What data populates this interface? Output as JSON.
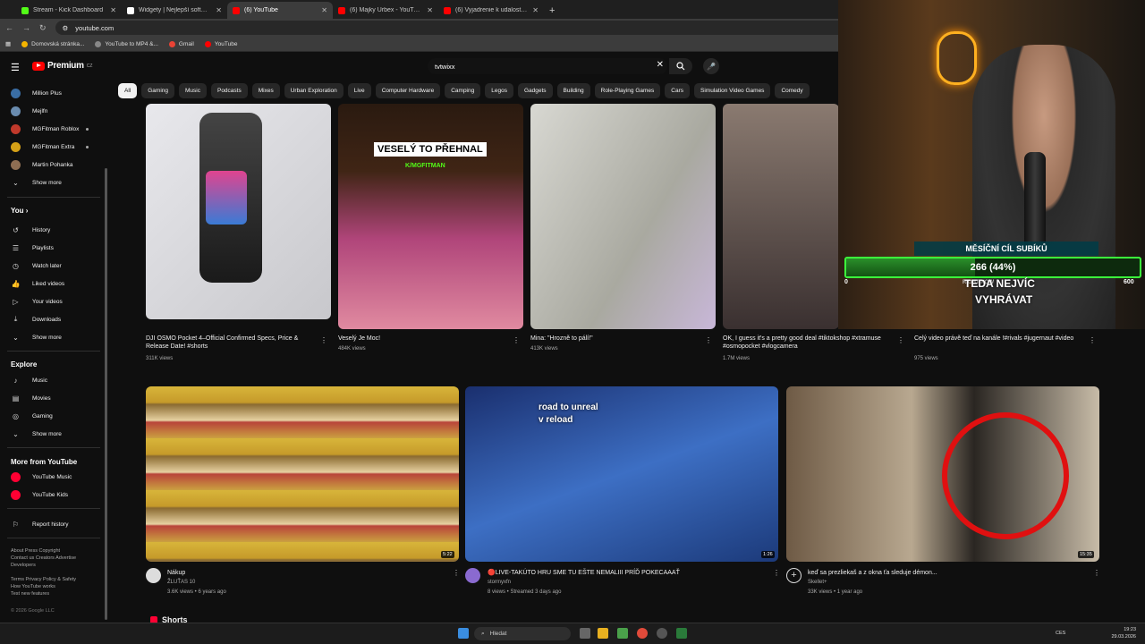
{
  "browser": {
    "tabs": [
      {
        "label": "Stream - Kick Dashboard",
        "favicon_color": "#53fc18"
      },
      {
        "label": "Widgety | Nejlepší software pro...",
        "favicon_color": "#ffffff"
      },
      {
        "label": "(6) YouTube",
        "favicon_color": "#ff0000",
        "active": true
      },
      {
        "label": "(6) Majky Urbex - YouTube",
        "favicon_color": "#ff0000"
      },
      {
        "label": "(6) Vyjadrenie k udalostiam v D...",
        "favicon_color": "#ff0000"
      }
    ],
    "url": "youtube.com",
    "bookmarks": [
      "Domovská stránka...",
      "YouTube to MP4 &...",
      "Gmail",
      "YouTube"
    ]
  },
  "youtube": {
    "brand": "Premium",
    "brand_sup": "CZ",
    "search_value": "tvtwixx",
    "chips": [
      "All",
      "Gaming",
      "Music",
      "Podcasts",
      "Mixes",
      "Urban Exploration",
      "Live",
      "Computer Hardware",
      "Camping",
      "Legos",
      "Gadgets",
      "Building",
      "Role-Playing Games",
      "Cars",
      "Simulation Video Games",
      "Comedy"
    ]
  },
  "sidebar": {
    "subscriptions": [
      {
        "label": "Million Plus",
        "color": "#3a6ea5"
      },
      {
        "label": "Mejlfn",
        "color": "#6a8caf"
      },
      {
        "label": "MGFitman Roblox",
        "color": "#c0392b"
      },
      {
        "label": "MGFitman Extra",
        "color": "#d4a017"
      },
      {
        "label": "Martin Pohanka",
        "color": "#8e6e53"
      }
    ],
    "show_more": "Show more",
    "you_heading": "You",
    "you_items": [
      "History",
      "Playlists",
      "Watch later",
      "Liked videos",
      "Your videos",
      "Downloads"
    ],
    "explore_heading": "Explore",
    "explore_items": [
      "Music",
      "Movies",
      "Gaming"
    ],
    "more_heading": "More from YouTube",
    "more_items": [
      "YouTube Music",
      "YouTube Kids"
    ],
    "report": "Report history",
    "footer1": "About  Press  Copyright",
    "footer2": "Contact us  Creators  Advertise",
    "footer3": "Developers",
    "footer4": "Terms  Privacy  Policy & Safety",
    "footer5": "How YouTube works",
    "footer6": "Test new features",
    "copyright": "© 2026 Google LLC"
  },
  "videos_row1": [
    {
      "title": "DJI OSMO Pocket 4–Official Confirmed Specs, Price & Release Date! #shorts",
      "meta": "311K views"
    },
    {
      "title": "Veselý Je Moc!",
      "meta": "484K views",
      "overlay": "VESELÝ TO PŘEHNAL",
      "overlay2": "K/MGFITMAN"
    },
    {
      "title": "Mina: \"Hrozně to pálí!\"",
      "meta": "413K views"
    },
    {
      "title": "OK, I guess it's a pretty good deal #tiktokshop #xtramuse #osmopocket #vlogcamera",
      "meta": "1.7M views"
    },
    {
      "title": "Celý video právě teď na kanále !#rivals #jugernaut #video",
      "meta": "975 views",
      "overlay": "TEDA NEJVÍC",
      "overlay2": "VYHRÁVAT"
    }
  ],
  "videos_row2": [
    {
      "title": "Nákup",
      "channel": "ŽLUŤAS 10",
      "meta": "3.6K views • 6 years ago",
      "duration": "5:22"
    },
    {
      "title": "🔴LIVE-TAKÚTO HRU SME TU EŠTE NEMALIII PRÍĎ POKECAAAŤ",
      "channel": "stormyxfn",
      "meta": "8 views • Streamed 3 days ago",
      "duration": "1:26",
      "overlay": "road to unreal",
      "overlay2": "v reload"
    },
    {
      "title": "keď sa prezliekaš a z okna ťa sleduje démon...",
      "channel": "Skellet+",
      "meta": "33K views • 1 year ago",
      "duration": "15:35"
    }
  ],
  "shorts_heading": "Shorts",
  "goal": {
    "title": "MĚSÍČNÍ CÍL SUBÍKŮ",
    "text": "266 (44%)",
    "fraction": 0.44,
    "min": "0",
    "max": "600",
    "right_now": "RIGHT NOW"
  },
  "taskbar": {
    "search": "Hledat",
    "lang": "CES",
    "time": "19:23",
    "date": "29.03.2026"
  }
}
